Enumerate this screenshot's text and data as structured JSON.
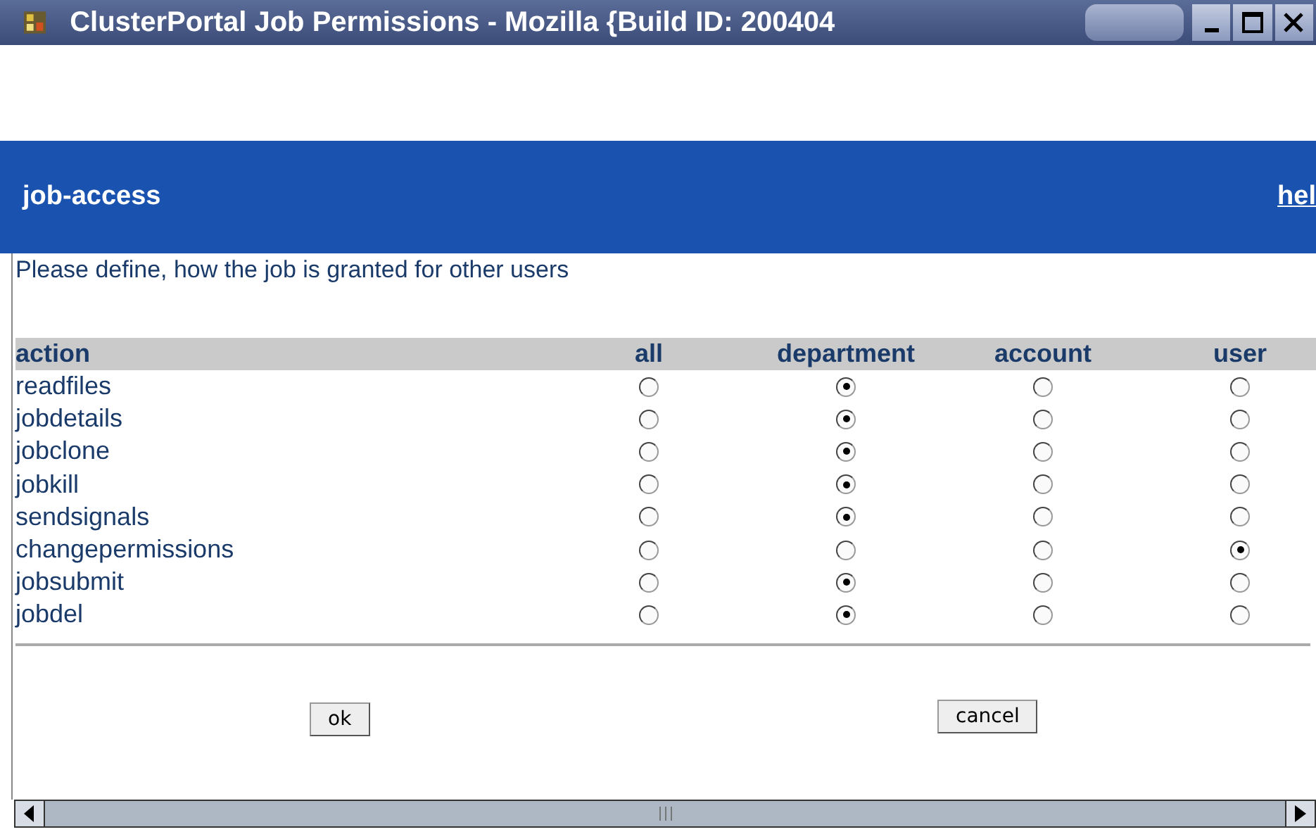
{
  "window": {
    "title": "ClusterPortal Job Permissions - Mozilla {Build ID: 200404"
  },
  "header": {
    "title": "job-access",
    "help_link": "hel"
  },
  "intro": "Please define, how the job is granted for other users",
  "table": {
    "columns": [
      "action",
      "all",
      "department",
      "account",
      "user"
    ],
    "rows": [
      {
        "action": "readfiles",
        "choices": [
          {
            "selected": false
          },
          {
            "selected": true
          },
          {
            "selected": false
          },
          {
            "selected": false
          }
        ]
      },
      {
        "action": "jobdetails",
        "choices": [
          {
            "selected": false
          },
          {
            "selected": true
          },
          {
            "selected": false
          },
          {
            "selected": false
          }
        ]
      },
      {
        "action": "jobclone",
        "choices": [
          {
            "selected": false
          },
          {
            "selected": true
          },
          {
            "selected": false
          },
          {
            "selected": false
          }
        ]
      },
      {
        "action": "jobkill",
        "choices": [
          {
            "selected": false
          },
          {
            "selected": true
          },
          {
            "selected": false
          },
          {
            "selected": false
          }
        ]
      },
      {
        "action": "sendsignals",
        "choices": [
          {
            "selected": false
          },
          {
            "selected": true
          },
          {
            "selected": false
          },
          {
            "selected": false
          }
        ]
      },
      {
        "action": "changepermissions",
        "choices": [
          {
            "selected": false
          },
          {
            "selected": false
          },
          {
            "selected": false
          },
          {
            "selected": true
          }
        ]
      },
      {
        "action": "jobsubmit",
        "choices": [
          {
            "selected": false
          },
          {
            "selected": true
          },
          {
            "selected": false
          },
          {
            "selected": false
          }
        ]
      },
      {
        "action": "jobdel",
        "choices": [
          {
            "selected": false
          },
          {
            "selected": true
          },
          {
            "selected": false
          },
          {
            "selected": false
          }
        ]
      }
    ]
  },
  "buttons": [
    "ok",
    "cancel"
  ]
}
